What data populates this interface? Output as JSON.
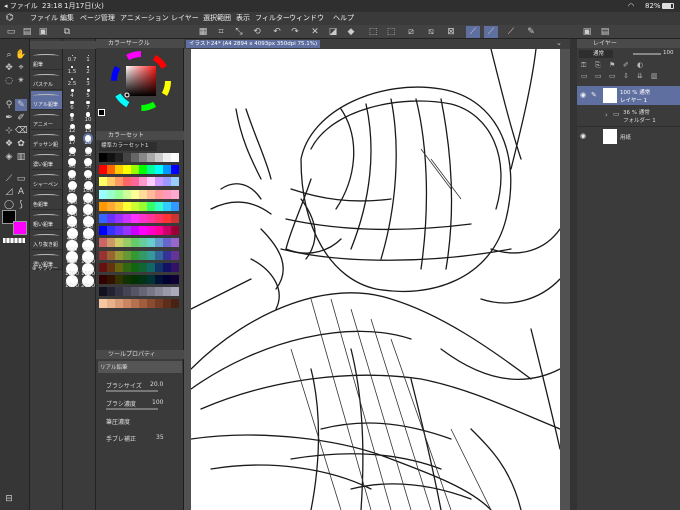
{
  "status": {
    "carrier": "◂ ファイル",
    "time": "23:18",
    "date": "1月17日(火)",
    "battery": "82%"
  },
  "menu": [
    "ファイル",
    "編集",
    "ページ管理",
    "アニメーション",
    "レイヤー",
    "選択範囲",
    "表示",
    "フィルター",
    "ウィンドウ",
    "ヘルプ"
  ],
  "brush_group": [
    "鉛筆",
    "パステル",
    "リアル鉛筆",
    "アニメー",
    "デッサン鉛",
    "濃い鉛筆",
    "シャーペン",
    "色鉛筆",
    "粗い鉛筆",
    "入り抜き鉛",
    "濃い鉛筆"
  ],
  "brush_group_short": [
    "鉛筆",
    "鉛筆"
  ],
  "sub_tool_add": "サブツー",
  "brush_sizes": [
    "0.7",
    "1",
    "1.5",
    "2",
    "2.5",
    "3",
    "4",
    "5",
    "6",
    "7",
    "8",
    "10",
    "12",
    "15",
    "17",
    "20",
    "25",
    "30",
    "40",
    "50",
    "60",
    "70",
    "80",
    "100",
    "120",
    "150",
    "170",
    "200",
    "250",
    "300",
    "400",
    "500",
    "600",
    "700",
    "800",
    "1000",
    "1200",
    "1500",
    "1700",
    "2000"
  ],
  "color_circle": {
    "title": "カラーサークル"
  },
  "color_set": {
    "title": "カラーセット",
    "selector": "標準カラーセット1"
  },
  "tool_property": {
    "title": "ツールプロパティ",
    "brush_name": "リアル鉛筆",
    "rows": [
      {
        "label": "ブラシサイズ",
        "value": "20.0"
      },
      {
        "label": "ブラシ濃度",
        "value": "100"
      },
      {
        "label": "筆圧濃度",
        "value": ""
      },
      {
        "label": "手ブレ補正",
        "value": "35"
      }
    ]
  },
  "canvas": {
    "tab": "イラスト24* (A4 2894 x 4093px 350dpi 75.1%)"
  },
  "layer_panel": {
    "title": "レイヤー",
    "blend": "通常",
    "opacity": "100",
    "layers": [
      {
        "pct": "100 % 通常",
        "name": "レイヤー 1"
      },
      {
        "pct": "36 % 通常",
        "name": "フォルダー 1"
      },
      {
        "pct": "",
        "name": "用紙"
      }
    ]
  },
  "colors": {
    "accent": "#5f6fa0",
    "main_color": "#000000",
    "sub_color": "#ff00ff"
  }
}
